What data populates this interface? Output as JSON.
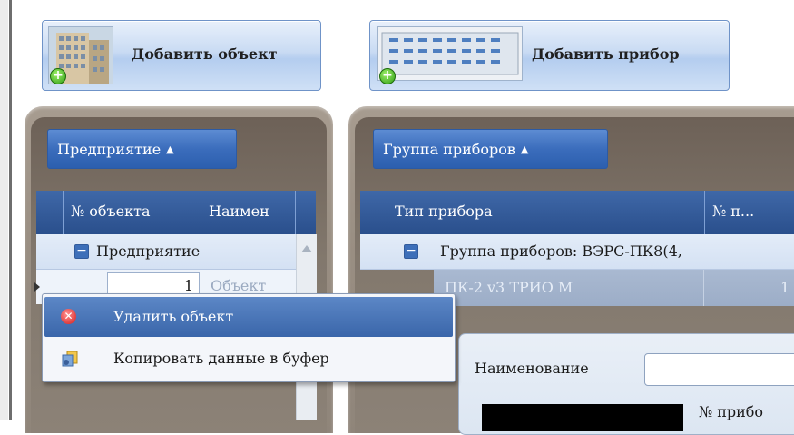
{
  "toolbar": {
    "add_object_label": "Добавить объект",
    "add_device_label": "Добавить прибор"
  },
  "left_panel": {
    "group_button": "Предприятие",
    "columns": [
      "№ объекта",
      "Наимен"
    ],
    "group_row_label": "Предприятие",
    "row": {
      "number": "1",
      "name": "Объект"
    }
  },
  "right_panel": {
    "group_button": "Группа приборов",
    "columns": [
      "Тип прибора",
      "№ п..."
    ],
    "group_row_label": "Группа приборов: ВЭРС-ПК8(4,",
    "row": {
      "type": "ПК-2 v3 ТРИО М",
      "number": "1"
    },
    "form": {
      "name_label": "Наименование",
      "name_value": "",
      "device_number_label": "№ прибо"
    }
  },
  "context_menu": {
    "items": [
      {
        "label": "Удалить объект",
        "icon": "delete-icon",
        "active": true
      },
      {
        "label": "Копировать данные в буфер",
        "icon": "copy-icon",
        "active": false
      }
    ]
  },
  "colors": {
    "accent_blue": "#3a66aa",
    "panel_brown": "#8f857a",
    "header_blue": "#2a4f8c"
  }
}
